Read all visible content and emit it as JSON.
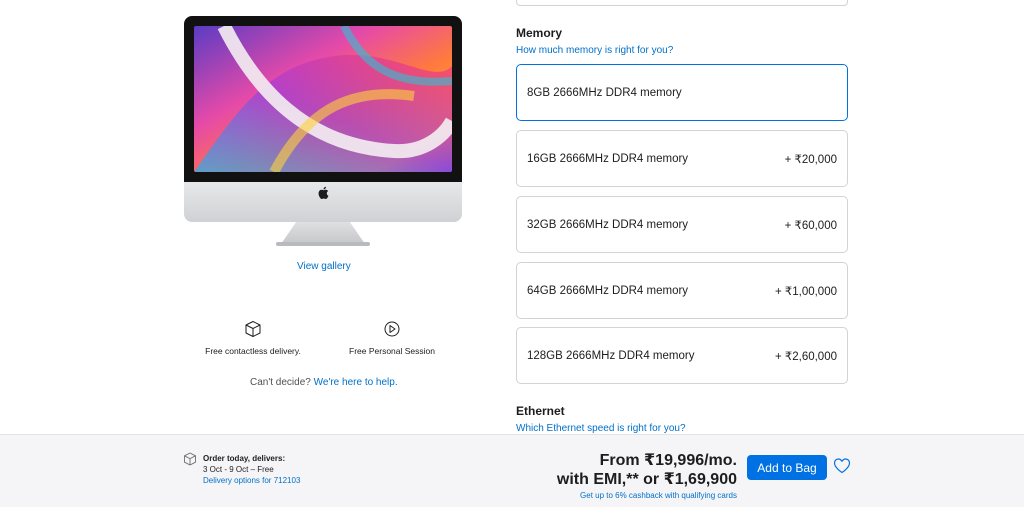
{
  "product": {
    "image_alt": "iMac",
    "view_gallery": "View gallery"
  },
  "perks": [
    {
      "icon": "box-icon",
      "label": "Free contactless delivery."
    },
    {
      "icon": "session-icon",
      "label": "Free Personal Session"
    }
  ],
  "help": {
    "prefix": "Can't decide?",
    "link": "We're here to help."
  },
  "memory": {
    "title": "Memory",
    "help_link": "How much memory is right for you?",
    "options": [
      {
        "label": "8GB 2666MHz DDR4 memory",
        "price": "",
        "selected": true
      },
      {
        "label": "16GB 2666MHz DDR4 memory",
        "price": "+ ₹20,000",
        "selected": false
      },
      {
        "label": "32GB 2666MHz DDR4 memory",
        "price": "+ ₹60,000",
        "selected": false
      },
      {
        "label": "64GB 2666MHz DDR4 memory",
        "price": "+ ₹1,00,000",
        "selected": false
      },
      {
        "label": "128GB 2666MHz DDR4 memory",
        "price": "+ ₹2,60,000",
        "selected": false
      }
    ]
  },
  "ethernet": {
    "title": "Ethernet",
    "help_link": "Which Ethernet speed is right for you?"
  },
  "bottom_bar": {
    "delivery_heading": "Order today, delivers:",
    "delivery_dates": "3 Oct - 9 Oct – Free",
    "delivery_options_link": "Delivery options for 712103",
    "price_line_1": "From ₹19,996/mo.",
    "price_line_2": "with EMI,** or ₹1,69,900",
    "cashback": "Get up to 6% cashback with qualifying cards",
    "add_to_bag": "Add to Bag"
  },
  "colors": {
    "accent": "#0071e3",
    "link": "#0070c9",
    "text": "#1d1d1f",
    "border": "#d2d2d7",
    "bar_background": "#f5f5f7"
  }
}
